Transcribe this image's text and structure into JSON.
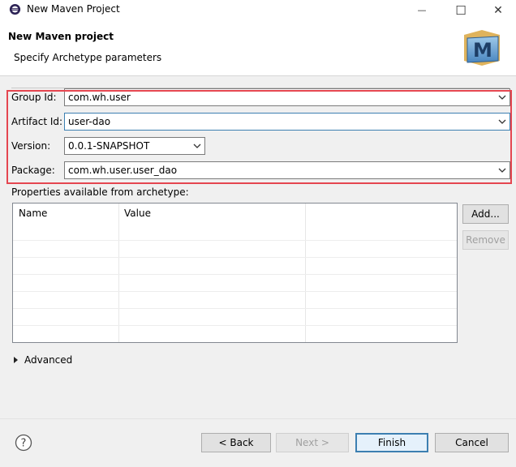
{
  "window": {
    "title": "New Maven Project",
    "minimize_glyph": "—",
    "maximize_glyph": "☐",
    "close_glyph": "✕"
  },
  "header": {
    "title": "New Maven project",
    "subtitle": "Specify Archetype parameters",
    "logo_letter": "M"
  },
  "form": {
    "group_id_label": "Group Id:",
    "group_id_value": "com.wh.user",
    "artifact_id_label": "Artifact Id:",
    "artifact_id_value": "user-dao",
    "version_label": "Version:",
    "version_value": "0.0.1-SNAPSHOT",
    "package_label": "Package:",
    "package_value": "com.wh.user.user_dao"
  },
  "properties": {
    "label": "Properties available from archetype:",
    "columns": [
      "Name",
      "Value"
    ],
    "add_label": "Add...",
    "remove_label": "Remove"
  },
  "advanced": {
    "label": "Advanced"
  },
  "footer": {
    "back_label": "< Back",
    "next_label": "Next >",
    "finish_label": "Finish",
    "cancel_label": "Cancel"
  },
  "colors": {
    "highlight_box": "#e54650",
    "focus_border": "#3c7fb1"
  },
  "icons": [
    "eclipse-app-icon",
    "minimize-icon",
    "maximize-icon",
    "close-icon",
    "maven-logo-icon",
    "dropdown-arrow-icon",
    "expand-triangle-icon",
    "help-icon"
  ]
}
